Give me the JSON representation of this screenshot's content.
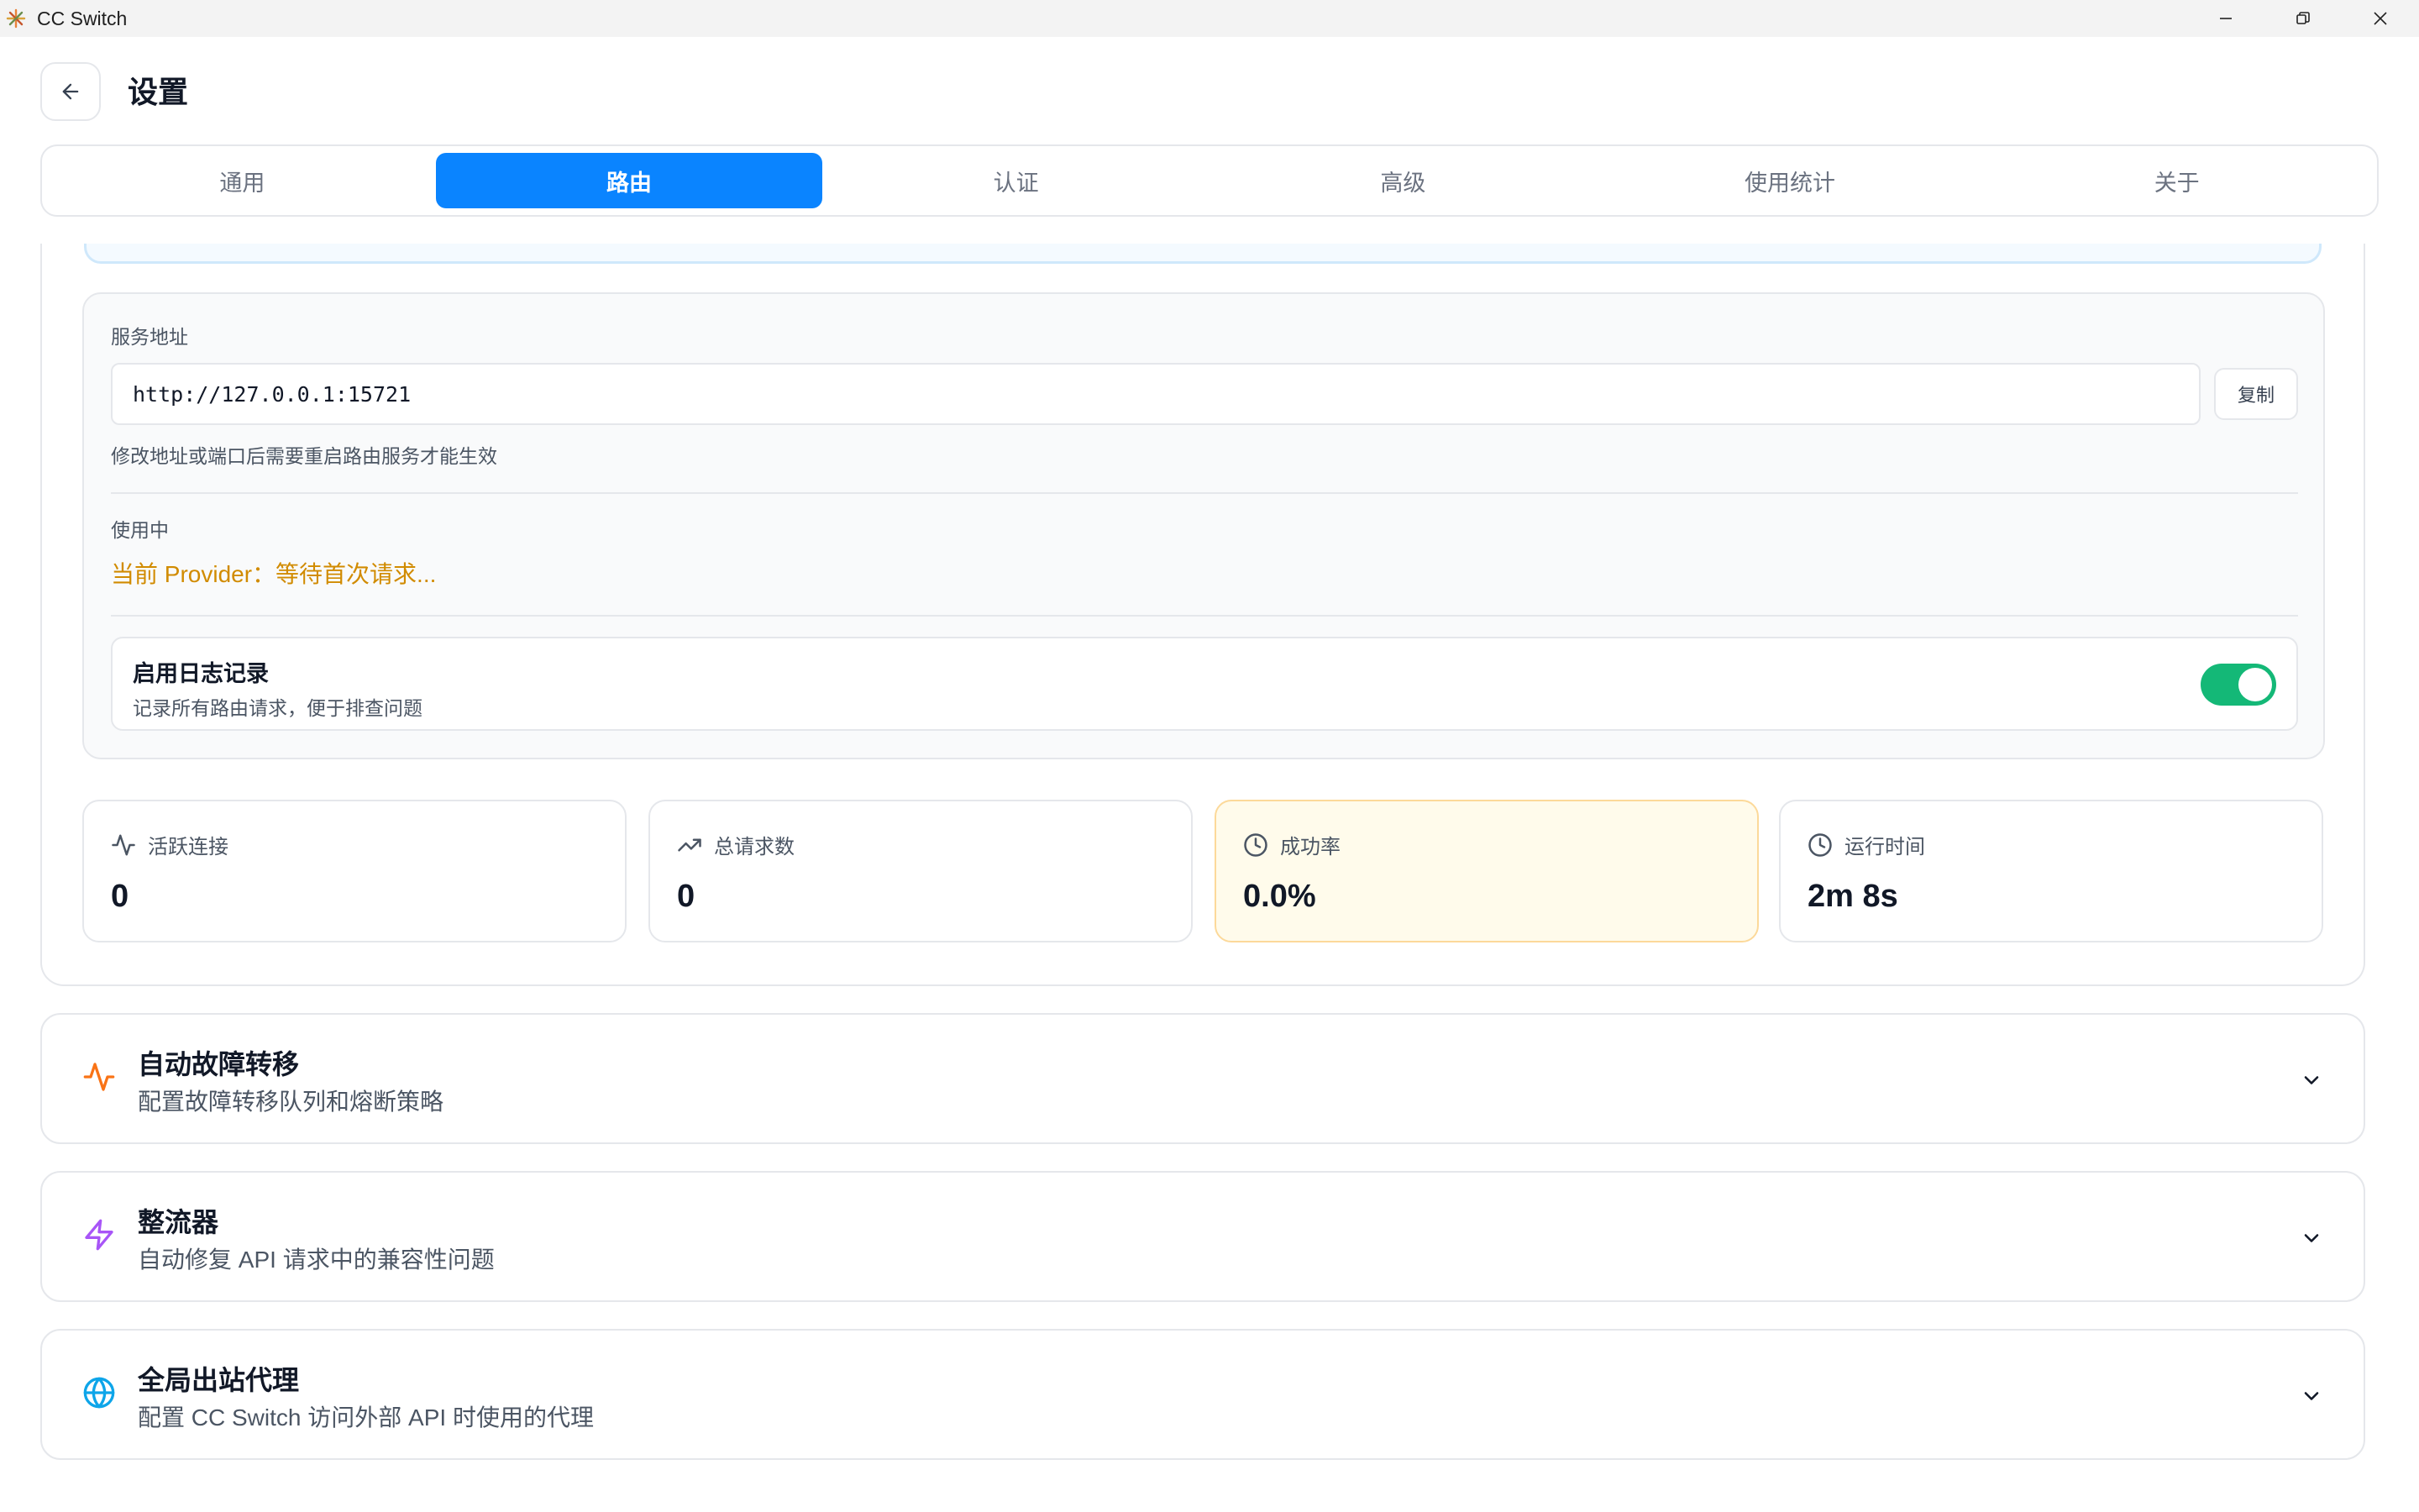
{
  "window": {
    "title": "CC Switch"
  },
  "header": {
    "title": "设置"
  },
  "tabs": [
    {
      "label": "通用"
    },
    {
      "label": "路由"
    },
    {
      "label": "认证"
    },
    {
      "label": "高级"
    },
    {
      "label": "使用统计"
    },
    {
      "label": "关于"
    }
  ],
  "active_tab": "路由",
  "service": {
    "address_label": "服务地址",
    "address_value": "http://127.0.0.1:15721",
    "copy_label": "复制",
    "hint": "修改地址或端口后需要重启路由服务才能生效",
    "in_use_label": "使用中",
    "current_provider": "当前 Provider：等待首次请求...",
    "logging": {
      "title": "启用日志记录",
      "description": "记录所有路由请求，便于排查问题",
      "enabled": true
    }
  },
  "stats": [
    {
      "label": "活跃连接",
      "value": "0",
      "icon": "activity-icon"
    },
    {
      "label": "总请求数",
      "value": "0",
      "icon": "trending-up-icon"
    },
    {
      "label": "成功率",
      "value": "0.0%",
      "icon": "clock-icon"
    },
    {
      "label": "运行时间",
      "value": "2m 8s",
      "icon": "clock-icon"
    }
  ],
  "sections": [
    {
      "title": "自动故障转移",
      "description": "配置故障转移队列和熔断策略",
      "icon": "activity-icon",
      "color": "#f97316"
    },
    {
      "title": "整流器",
      "description": "自动修复 API 请求中的兼容性问题",
      "icon": "zap-icon",
      "color": "#a855f7"
    },
    {
      "title": "全局出站代理",
      "description": "配置 CC Switch 访问外部 API 时使用的代理",
      "icon": "globe-icon",
      "color": "#0ea5e9"
    }
  ],
  "colors": {
    "accent": "#0a84ff",
    "toggle_on": "#14b877",
    "provider_text": "#d18b00",
    "highlight_card_bg": "#fffbeb"
  }
}
